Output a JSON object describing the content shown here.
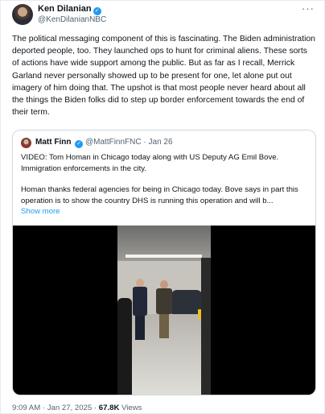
{
  "author": {
    "name": "Ken Dilanian",
    "handle": "@KenDilanianNBC",
    "verified_icon": "verified-badge-icon"
  },
  "tweet": {
    "text": "The political messaging component of this is fascinating.  The Biden administration deported people, too.  They launched ops to hunt for criminal aliens. These sorts of actions have wide support among the public. But as far as I recall, Merrick Garland never personally showed up to be  present for one, let alone put out imagery of him doing that.  The upshot is that most people never heard about all the things the Biden folks did to step up border enforcement towards the end of their term."
  },
  "quote": {
    "name": "Matt Finn",
    "handle": "@MattFinnFNC",
    "separator": "·",
    "date": "Jan 26",
    "text_1": "VIDEO:   Tom Homan in Chicago today along with US Deputy AG Emil Bove. Immigration enforcements in the city.",
    "text_2": "Homan thanks federal agencies for being in Chicago today.   Bove says in part this operation is to show the country DHS is running this operation and will b...",
    "show_more": "Show more"
  },
  "meta": {
    "time": "9:09 AM",
    "separator": "·",
    "date": "Jan 27, 2025",
    "views_count": "67.8K",
    "views_label": "Views"
  },
  "colors": {
    "accent": "#1d9bf0",
    "text": "#0f1419",
    "secondary": "#536471",
    "border": "#cfd9de"
  }
}
